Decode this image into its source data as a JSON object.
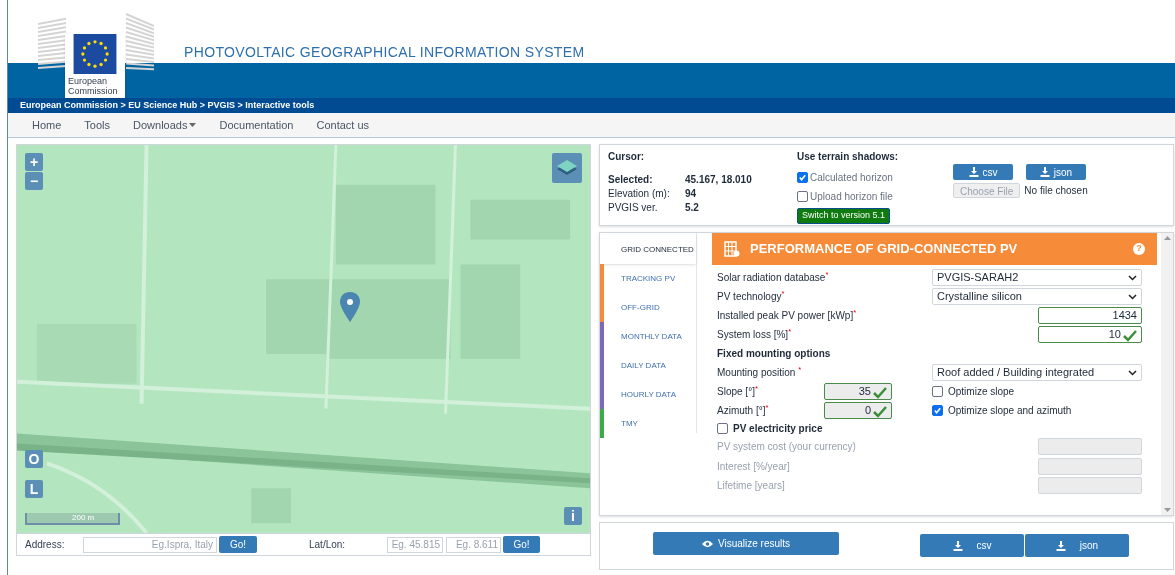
{
  "header": {
    "logo_text": "European Commission",
    "title": "PHOTOVOLTAIC GEOGRAPHICAL INFORMATION SYSTEM"
  },
  "breadcrumb": "European Commission > EU Science Hub > PVGIS > Interactive tools",
  "nav": [
    {
      "label": "Home",
      "dropdown": false
    },
    {
      "label": "Tools",
      "dropdown": false
    },
    {
      "label": "Downloads",
      "dropdown": true
    },
    {
      "label": "Documentation",
      "dropdown": false
    },
    {
      "label": "Contact us",
      "dropdown": false
    }
  ],
  "map": {
    "zoom_in": "+",
    "zoom_out": "−",
    "buttons": [
      "O",
      "L"
    ],
    "info": "i",
    "scale": "200 m"
  },
  "address_bar": {
    "address_label": "Address:",
    "address_placeholder": "Eg.Ispra, Italy",
    "go": "Go!",
    "latlon_label": "Lat/Lon:",
    "lat_placeholder": "Eg. 45.815",
    "lon_placeholder": "Eg. 8.611",
    "go2": "Go!"
  },
  "info": {
    "cursor_label": "Cursor:",
    "rows": [
      {
        "label": "Selected:",
        "value": "45.167, 18.010",
        "bold": true
      },
      {
        "label": "Elevation (m):",
        "value": "94",
        "bold": false
      },
      {
        "label": "PVGIS ver.",
        "value": "5.2",
        "bold": false
      }
    ],
    "shadows_title": "Use terrain shadows:",
    "options": [
      {
        "label": "Calculated horizon",
        "checked": true
      },
      {
        "label": "Upload horizon file",
        "checked": false
      }
    ],
    "switch_button": "Switch to version 5.1",
    "download": [
      "csv",
      "json"
    ],
    "choose_file": "Choose File",
    "no_file": "No file chosen"
  },
  "tabs": [
    {
      "label": "GRID CONNECTED",
      "selected": true,
      "color": "#ffffff"
    },
    {
      "label": "TRACKING PV",
      "selected": false,
      "color": "#f58a3c"
    },
    {
      "label": "OFF-GRID",
      "selected": false,
      "color": "#f58a3c"
    },
    {
      "label": "MONTHLY DATA",
      "selected": false,
      "color": "#7b68b8"
    },
    {
      "label": "DAILY DATA",
      "selected": false,
      "color": "#7b68b8"
    },
    {
      "label": "HOURLY DATA",
      "selected": false,
      "color": "#7b68b8"
    },
    {
      "label": "TMY",
      "selected": false,
      "color": "#3cab4a"
    }
  ],
  "panel": {
    "title": "PERFORMANCE OF GRID-CONNECTED PV",
    "help": "?",
    "fields": [
      {
        "kind": "select",
        "label": "Solar radiation database",
        "mark": "*",
        "value": "PVGIS-SARAH2"
      },
      {
        "kind": "select",
        "label": "PV technology",
        "mark": "*",
        "value": "Crystalline silicon"
      },
      {
        "kind": "input",
        "label": "Installed peak PV power [kWp]",
        "mark": "*",
        "value": "1434",
        "valid": false
      },
      {
        "kind": "input",
        "label": "System loss [%]",
        "mark": "*",
        "value": "10",
        "valid": true
      },
      {
        "kind": "heading",
        "label": "Fixed mounting options"
      },
      {
        "kind": "select",
        "label": "Mounting position ",
        "mark": "*",
        "value": "Roof added / Building integrated"
      }
    ],
    "angles": [
      {
        "label": "Slope [°]",
        "mark": "*",
        "value": "35",
        "option": "Optimize slope",
        "checked": false
      },
      {
        "label": "Azimuth [°]",
        "mark": "*",
        "value": "0",
        "option": "Optimize slope and azimuth",
        "checked": true
      }
    ],
    "price": {
      "label": "PV electricity price",
      "checked": false,
      "fields": [
        "PV system cost (your currency)",
        "Interest [%/year]",
        "Lifetime [years]"
      ]
    }
  },
  "actions": {
    "visualize": "Visualize results",
    "download": [
      "csv",
      "json"
    ]
  }
}
